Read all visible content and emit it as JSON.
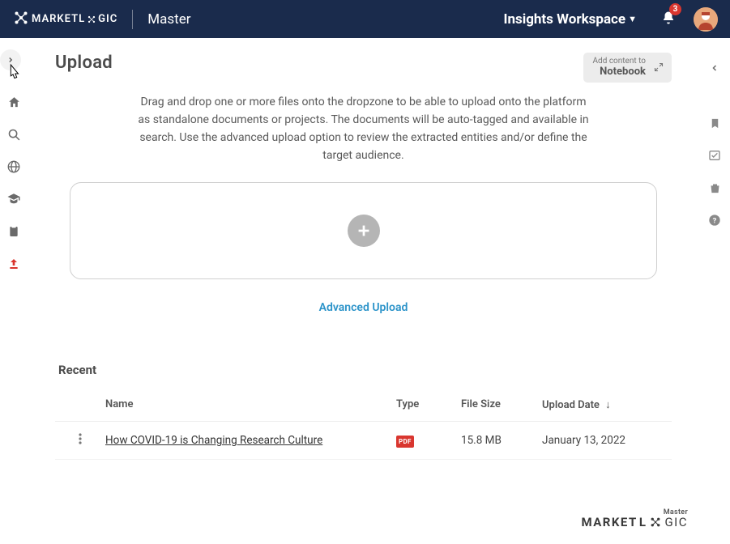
{
  "header": {
    "brand_prefix": "MARKET",
    "brand_suffix": "L",
    "brand_suffix2": "GIC",
    "master_label": "Master",
    "workspace_label": "Insights Workspace",
    "notification_count": "3"
  },
  "sidebar_left_icons": [
    "chevron",
    "home",
    "search",
    "globe",
    "graduation",
    "clipboard",
    "upload"
  ],
  "sidebar_right_icons": [
    "chevron-left",
    "bookmark",
    "checkbox",
    "trash",
    "help"
  ],
  "notebook": {
    "small": "Add content to",
    "large": "Notebook"
  },
  "page": {
    "title": "Upload",
    "instructions": "Drag and drop one or more files onto the dropzone to be able to upload onto the platform as standalone documents or projects. The documents will be auto-tagged and available in search. Use the advanced upload option to review the extracted entities and/or define the target audience.",
    "advanced_link": "Advanced Upload"
  },
  "recent": {
    "heading": "Recent",
    "columns": {
      "name": "Name",
      "type": "Type",
      "size": "File Size",
      "date": "Upload Date"
    },
    "rows": [
      {
        "name": "How COVID-19 is Changing Research Culture",
        "type": "PDF",
        "size": "15.8 MB",
        "date": "January 13, 2022"
      }
    ]
  },
  "footer": {
    "small": "Master",
    "big_prefix": "MARKET",
    "big_l": "L",
    "big_gic": "GIC"
  }
}
